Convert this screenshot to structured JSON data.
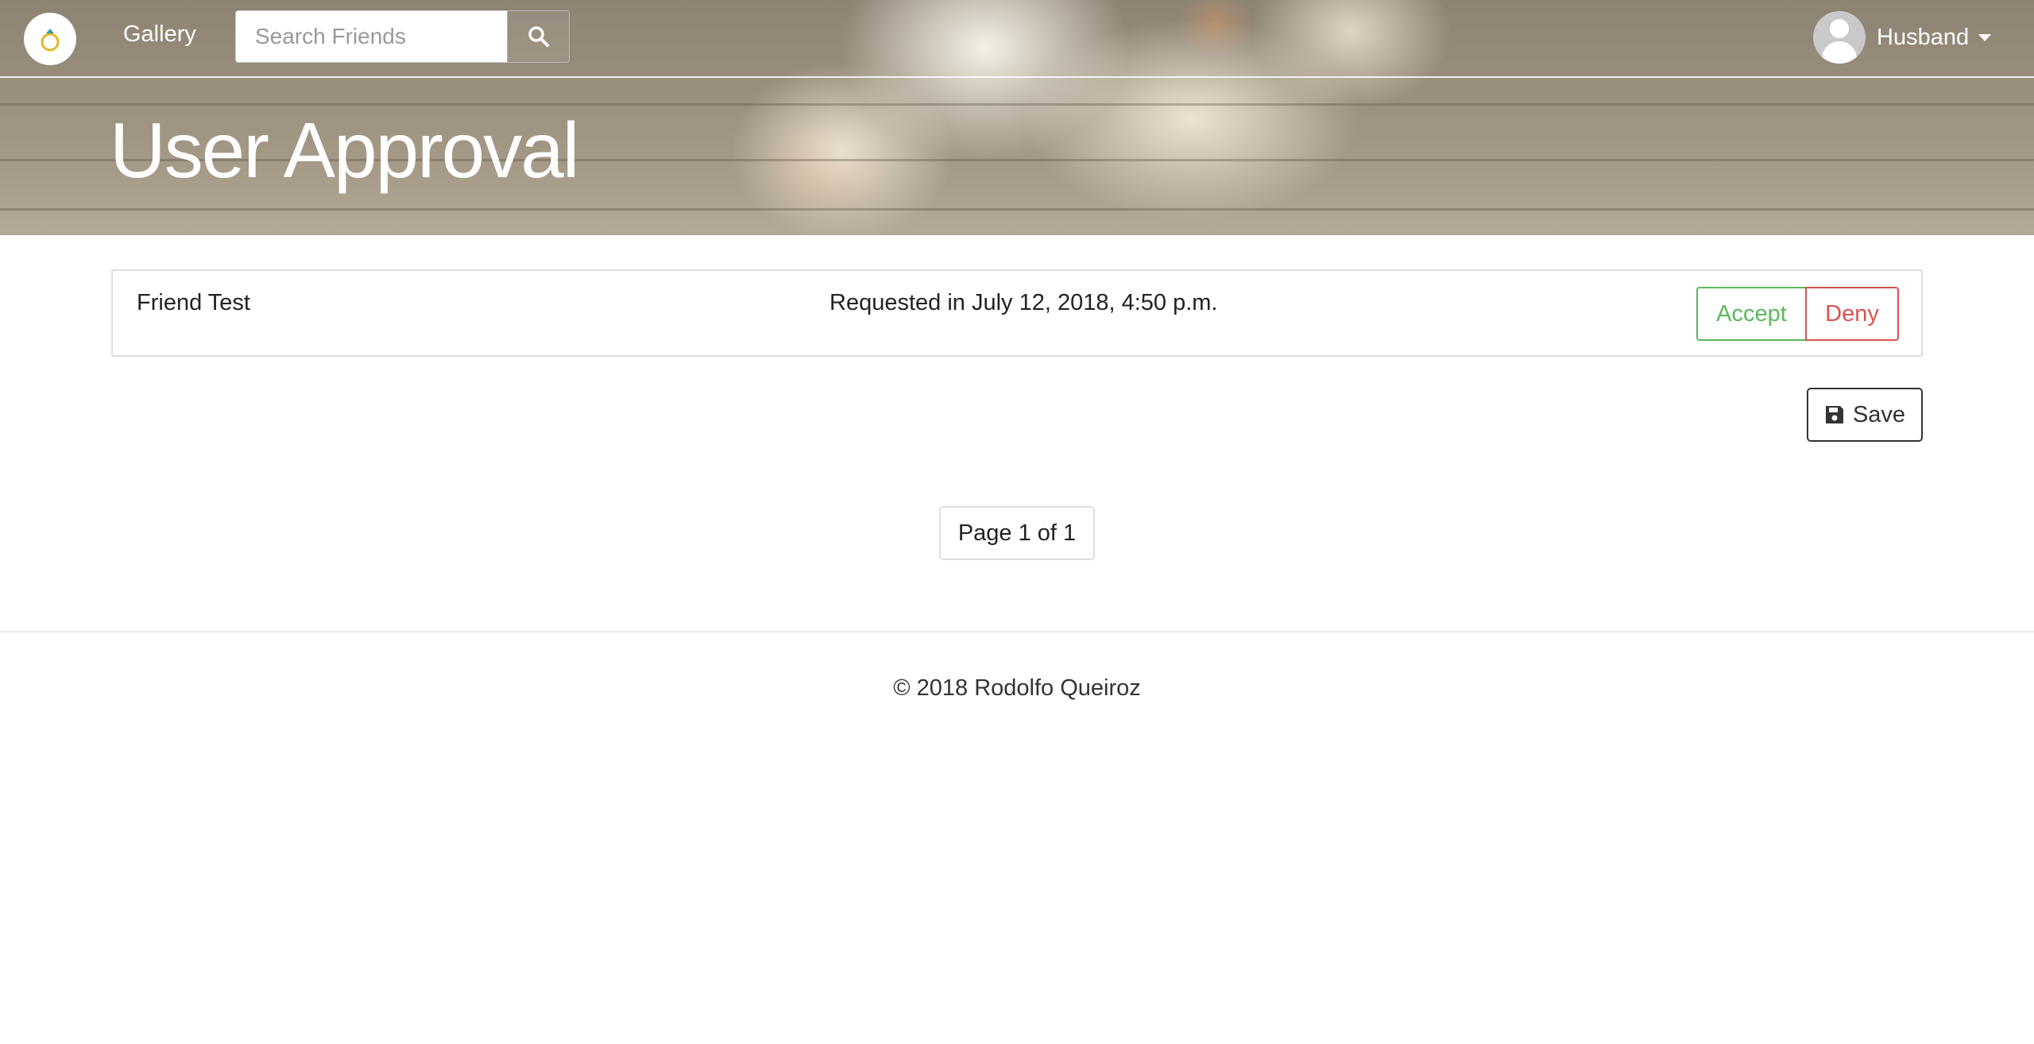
{
  "navbar": {
    "logo_name": "ring-logo",
    "gallery_label": "Gallery",
    "search_placeholder": "Search Friends",
    "search_icon": "search-icon",
    "user_name": "Husband",
    "avatar_icon": "user-avatar-icon"
  },
  "header": {
    "title": "User Approval"
  },
  "requests": [
    {
      "name": "Friend Test",
      "requested": "Requested in July 12, 2018, 4:50 p.m.",
      "accept_label": "Accept",
      "deny_label": "Deny"
    }
  ],
  "actions": {
    "save_label": "Save",
    "save_icon": "floppy-disk-icon"
  },
  "pagination": {
    "label": "Page 1 of 1"
  },
  "footer": {
    "copyright": "© 2018 Rodolfo Queiroz"
  },
  "colors": {
    "accept": "#5cb85c",
    "deny": "#d9534f"
  }
}
